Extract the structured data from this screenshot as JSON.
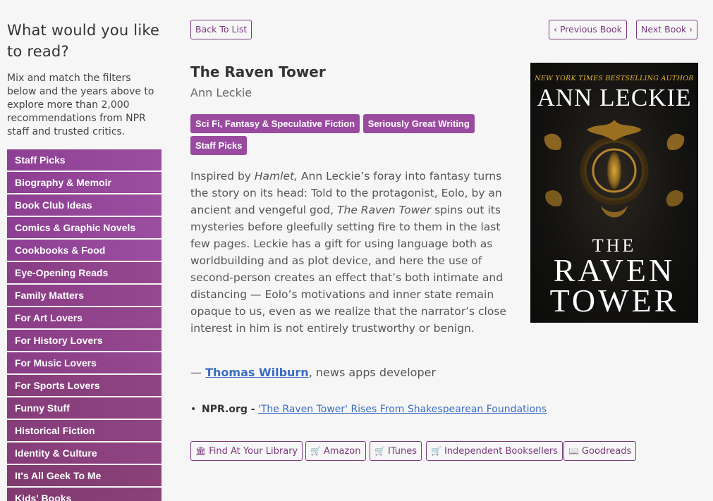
{
  "sidebar": {
    "heading": "What would you like to read?",
    "intro": "Mix and match the filters below and the years above to explore more than 2,000 recommendations from NPR staff and trusted critics.",
    "categories": [
      "Staff Picks",
      "Biography & Memoir",
      "Book Club Ideas",
      "Comics & Graphic Novels",
      "Cookbooks & Food",
      "Eye-Opening Reads",
      "Family Matters",
      "For Art Lovers",
      "For History Lovers",
      "For Music Lovers",
      "For Sports Lovers",
      "Funny Stuff",
      "Historical Fiction",
      "Identity & Culture",
      "It's All Geek To Me",
      "Kids' Books"
    ]
  },
  "nav": {
    "back": "Back To List",
    "prev": "‹ Previous Book",
    "next": "Next Book ›"
  },
  "book": {
    "title": "The Raven Tower",
    "author": "Ann Leckie",
    "tags": [
      "Sci Fi, Fantasy & Speculative Fiction",
      "Seriously Great Writing",
      "Staff Picks"
    ],
    "description": {
      "p1": "Inspired by ",
      "em1": "Hamlet,",
      "p2": " Ann Leckie’s foray into fantasy turns the story on its head: Told to the protagonist, Eolo, by an ancient and vengeful god, ",
      "em2": "The Raven Tower",
      "p3": " spins out its mysteries before gleefully setting fire to them in the last few pages. Leckie has a gift for using language both as worldbuilding and as plot device, and here the use of second-person creates an effect that’s both intimate and distancing — Eolo’s motivations and inner state remain opaque to us, even as we realize that the narrator’s close interest in him is not entirely trustworthy or benign."
    },
    "attribution": {
      "dash": "— ",
      "name": "Thomas Wilburn",
      "role": ", news apps developer"
    },
    "cover": {
      "tagline": "NEW YORK TIMES BESTSELLING AUTHOR",
      "author": "ANN LECKIE",
      "title_line1": "THE",
      "title_line2": "RAVEN",
      "title_line3": "TOWER",
      "accent_color": "#e6b83a"
    },
    "reviews": [
      {
        "source": "NPR.org -",
        "link": "'The Raven Tower' Rises From Shakespearean Foundations"
      }
    ]
  },
  "buy": [
    {
      "icon": "library-icon",
      "glyph": "🏛",
      "label": "Find At Your Library"
    },
    {
      "icon": "cart-icon",
      "glyph": "🛒",
      "label": "Amazon"
    },
    {
      "icon": "cart-icon",
      "glyph": "🛒",
      "label": "ITunes"
    },
    {
      "icon": "cart-icon",
      "glyph": "🛒",
      "label": "Independent Booksellers"
    },
    {
      "icon": "book-icon",
      "glyph": "📖",
      "label": "Goodreads"
    }
  ],
  "colors": {
    "accent": "#9a4ba0",
    "link": "#3b6cc4",
    "border": "#7b3a7f"
  }
}
